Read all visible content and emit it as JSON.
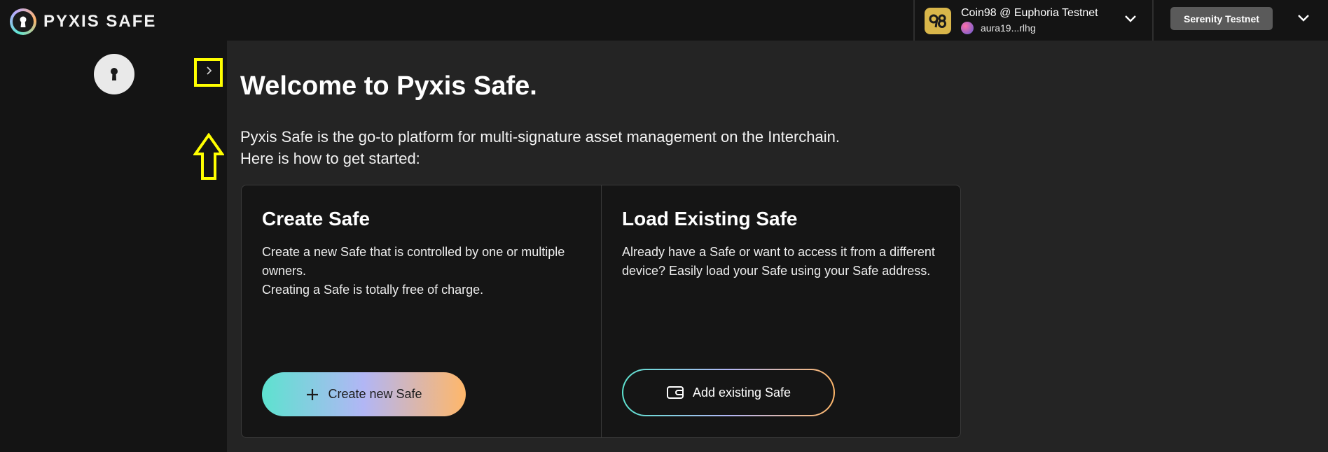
{
  "header": {
    "logo_text": "PYXIS SAFE",
    "wallet": {
      "name": "Coin98 @ Euphoria Testnet",
      "address": "aura19...rlhg",
      "icon": "coin98-logo-icon"
    },
    "network_label": "Serenity Testnet"
  },
  "sidebar": {
    "safe_icon": "keyhole-icon",
    "expand_icon": "chevron-right-icon"
  },
  "main": {
    "title": "Welcome to Pyxis Safe.",
    "intro_line1": "Pyxis Safe is the go-to platform for multi-signature asset management on the Interchain.",
    "intro_line2": "Here is how to get started:",
    "cards": [
      {
        "title": "Create Safe",
        "desc_line1": "Create a new Safe that is controlled by one or multiple owners.",
        "desc_line2": "Creating a Safe is totally free of charge.",
        "button_label": "Create new Safe",
        "button_icon": "plus-icon"
      },
      {
        "title": "Load Existing Safe",
        "desc": "Already have a Safe or want to access it from a different device? Easily load your Safe using your Safe address.",
        "button_label": "Add existing Safe",
        "button_icon": "wallet-icon"
      }
    ]
  },
  "colors": {
    "background": "#242424",
    "panel": "#141414",
    "gradient_start": "#5de2cf",
    "gradient_mid": "#b2b6f5",
    "gradient_end": "#ffb76a",
    "annotation": "#ffff00"
  }
}
